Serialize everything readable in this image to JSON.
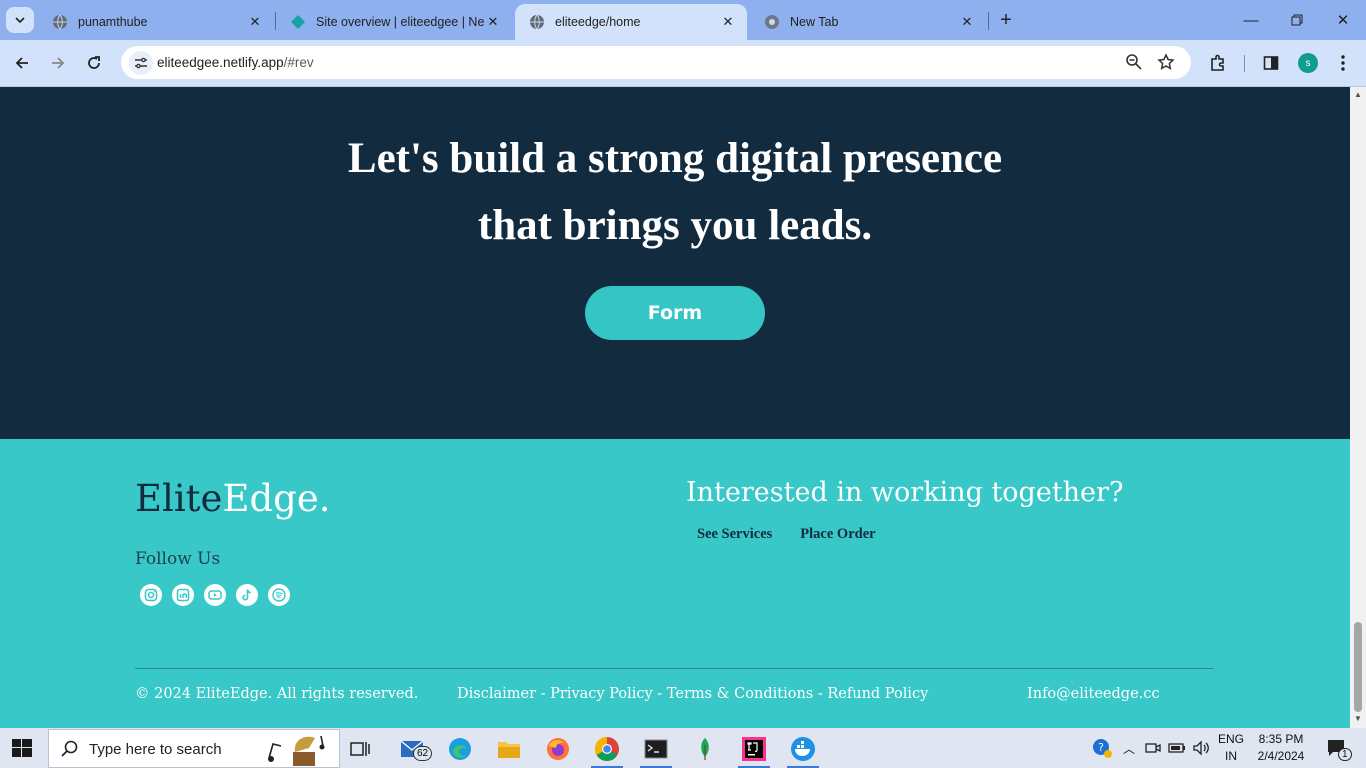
{
  "browser": {
    "tabs": [
      {
        "title": "punamthube",
        "active": false
      },
      {
        "title": "Site overview | eliteedgee | Netl",
        "active": false
      },
      {
        "title": "eliteedge/home",
        "active": true
      },
      {
        "title": "New Tab",
        "active": false
      }
    ],
    "url_host": "eliteedgee.netlify.app",
    "url_path": "/#rev",
    "profile_initial": "s"
  },
  "hero": {
    "title_line1": "Let's build a strong digital presence",
    "title_line2": "that brings you leads.",
    "form_button": "Form"
  },
  "footer": {
    "brand_part1": "Elite",
    "brand_part2": "Edge.",
    "follow_label": "Follow Us",
    "socials": [
      "instagram-icon",
      "linkedin-icon",
      "youtube-icon",
      "tiktok-icon",
      "spotify-icon"
    ],
    "interested": "Interested in working together?",
    "links": [
      "See Services",
      "Place Order"
    ],
    "copyright": "© 2024 EliteEdge. All rights reserved.",
    "legal": "Disclaimer - Privacy Policy - Terms & Conditions - Refund Policy",
    "email": "Info@eliteedge.cc"
  },
  "taskbar": {
    "search_placeholder": "Type here to search",
    "mail_badge": "62",
    "lang_line1": "ENG",
    "lang_line2": "IN",
    "time": "8:35 PM",
    "date": "2/4/2024",
    "notification_count": "1"
  },
  "colors": {
    "hero_bg": "#132b3f",
    "accent_teal": "#38c8c8",
    "button_teal": "#35c5c5"
  }
}
